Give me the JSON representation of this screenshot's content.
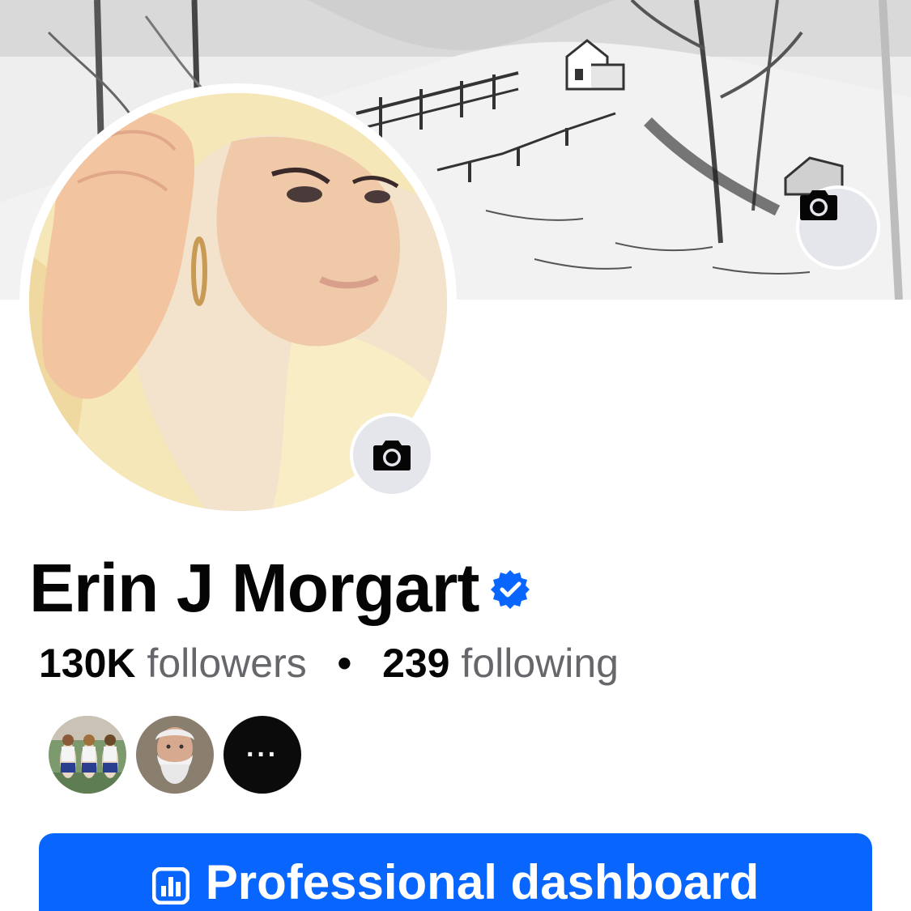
{
  "profile": {
    "name": "Erin J Morgart",
    "verified_icon": "verified-badge-icon",
    "followers_count": "130K",
    "followers_label": "followers",
    "separator": "•",
    "following_count": "239",
    "following_label": "following"
  },
  "cover": {
    "camera_icon": "camera-icon"
  },
  "avatar": {
    "camera_icon": "camera-icon"
  },
  "friends": {
    "more_label": "···"
  },
  "dashboard": {
    "label": "Professional dashboard",
    "icon": "bar-chart-icon"
  },
  "colors": {
    "accent": "#0866ff",
    "verified": "#0866ff",
    "text_primary": "#050505",
    "text_secondary": "#65676b",
    "camera_button_bg": "#e4e6eb"
  }
}
